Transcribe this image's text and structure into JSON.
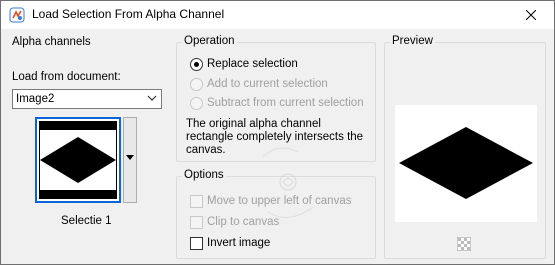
{
  "window": {
    "title": "Load Selection From Alpha Channel",
    "close_icon": "close-icon"
  },
  "alpha": {
    "group_title": "Alpha channels",
    "load_label": "Load from document:",
    "document_value": "Image2",
    "thumb_caption": "Selectie 1"
  },
  "operation": {
    "group_title": "Operation",
    "replace": "Replace selection",
    "add": "Add to current selection",
    "subtract": "Subtract from current selection",
    "selected": "replace",
    "note": "The original alpha channel rectangle completely intersects the canvas."
  },
  "options": {
    "group_title": "Options",
    "move": "Move to upper left of canvas",
    "clip": "Clip to canvas",
    "invert": "Invert image"
  },
  "preview": {
    "group_title": "Preview",
    "checker_icon": "transparency-checker-icon"
  },
  "colors": {
    "accent": "#0a64d6",
    "disabled_text": "#a0a0a0",
    "background": "#f0f0f0"
  }
}
